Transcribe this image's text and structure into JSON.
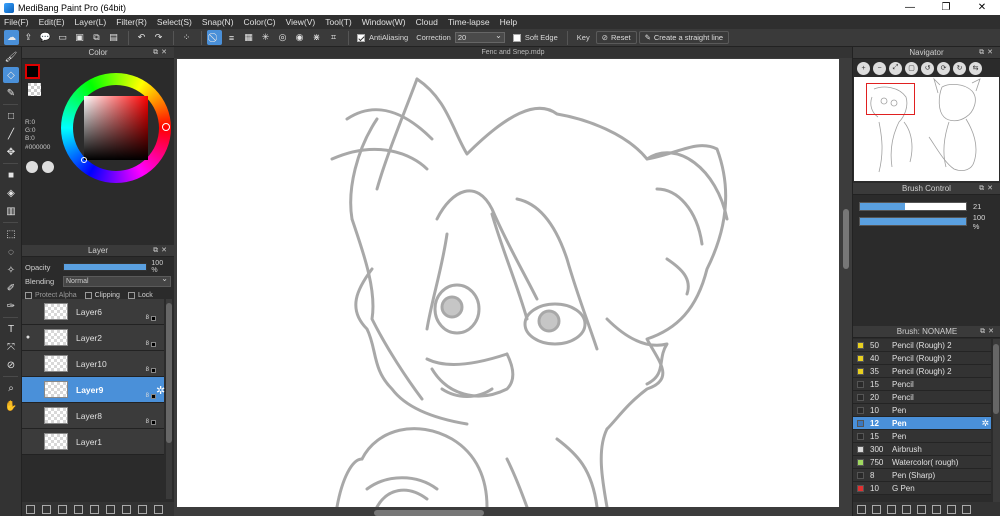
{
  "window": {
    "title": "MediBang Paint Pro (64bit)",
    "controls": [
      "—",
      "❐",
      "✕"
    ]
  },
  "menu": [
    "File(F)",
    "Edit(E)",
    "Layer(L)",
    "Filter(R)",
    "Select(S)",
    "Snap(N)",
    "Color(C)",
    "View(V)",
    "Tool(T)",
    "Window(W)",
    "Cloud",
    "Time-lapse",
    "Help"
  ],
  "toolbar": {
    "antialiasing_label": "AntiAliasing",
    "correction_label": "Correction",
    "correction_value": "20",
    "soft_edge_label": "Soft Edge",
    "key_label": "Key",
    "reset_label": "Reset",
    "straight_line_label": "Create a straight line"
  },
  "color_panel": {
    "title": "Color",
    "r": "R:0",
    "g": "G:0",
    "b": "B:0",
    "hex": "#000000",
    "foreground": "#000000",
    "accent": "#e01010"
  },
  "layer_panel": {
    "title": "Layer",
    "opacity_label": "Opacity",
    "opacity_value": "100 %",
    "opacity_fraction": 1.0,
    "blending_label": "Blending",
    "blending_value": "Normal",
    "protect_alpha_label": "Protect Alpha",
    "clipping_label": "Clipping",
    "lock_label": "Lock",
    "layers": [
      {
        "name": "Layer6",
        "bits": "8",
        "visible": false,
        "active": false
      },
      {
        "name": "Layer2",
        "bits": "8",
        "visible": true,
        "active": false
      },
      {
        "name": "Layer10",
        "bits": "8",
        "visible": false,
        "active": false
      },
      {
        "name": "Layer9",
        "bits": "8",
        "visible": false,
        "active": true
      },
      {
        "name": "Layer8",
        "bits": "8",
        "visible": false,
        "active": false
      },
      {
        "name": "Layer1",
        "bits": "",
        "visible": false,
        "active": false
      }
    ]
  },
  "document": {
    "tab_title": "Fenc and Snep.mdp"
  },
  "navigator": {
    "title": "Navigator"
  },
  "brush_control": {
    "title": "Brush Control",
    "size_value": "21",
    "size_fraction": 0.42,
    "opacity_value": "100 %",
    "opacity_fraction": 1.0
  },
  "brush_panel": {
    "title": "Brush: NONAME",
    "brushes": [
      {
        "size": "50",
        "name": "Pencil (Rough) 2",
        "color": "#e8d020",
        "active": false
      },
      {
        "size": "40",
        "name": "Pencil (Rough) 2",
        "color": "#e8d020",
        "active": false
      },
      {
        "size": "35",
        "name": "Pencil (Rough) 2",
        "color": "#e8d020",
        "active": false
      },
      {
        "size": "15",
        "name": "Pencil",
        "color": "#2a2a2a",
        "active": false
      },
      {
        "size": "20",
        "name": "Pencil",
        "color": "#2a2a2a",
        "active": false
      },
      {
        "size": "10",
        "name": "Pen",
        "color": "#2a2a2a",
        "active": false
      },
      {
        "size": "12",
        "name": "Pen",
        "color": "#3a78c0",
        "active": true
      },
      {
        "size": "15",
        "name": "Pen",
        "color": "#2a2a2a",
        "active": false
      },
      {
        "size": "300",
        "name": "Airbrush",
        "color": "#d8d8d8",
        "active": false
      },
      {
        "size": "750",
        "name": "Watercolor( rough)",
        "color": "#a0d860",
        "active": false
      },
      {
        "size": "8",
        "name": "Pen (Sharp)",
        "color": "#2a2a2a",
        "active": false
      },
      {
        "size": "10",
        "name": "G Pen",
        "color": "#e03030",
        "active": false
      }
    ]
  }
}
